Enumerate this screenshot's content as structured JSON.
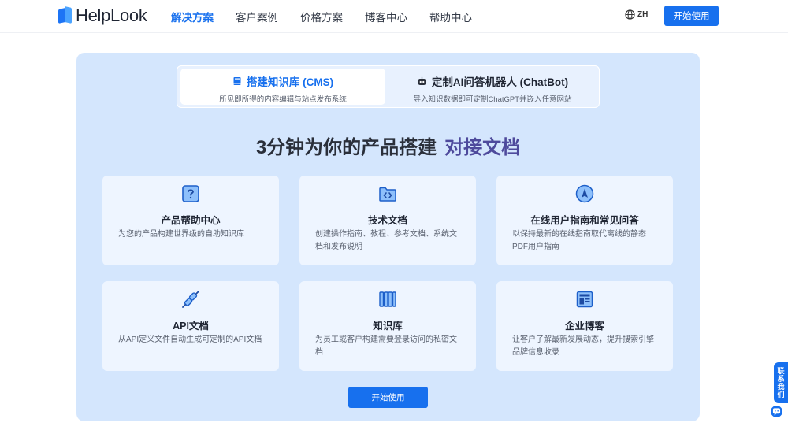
{
  "header": {
    "logo_text": "HelpLook",
    "nav": [
      "解决方案",
      "客户案例",
      "价格方案",
      "博客中心",
      "帮助中心"
    ],
    "active_nav": "解决方案",
    "language": "ZH",
    "cta": "开始使用"
  },
  "tabs": [
    {
      "title": "搭建知识库 (CMS)",
      "subtitle": "所见即所得的内容编辑与站点发布系统",
      "icon": "book-icon",
      "selected": true
    },
    {
      "title": "定制AI问答机器人 (ChatBot)",
      "subtitle": "导入知识数据即可定制ChatGPT并嵌入任意网站",
      "icon": "robot-icon",
      "selected": false
    }
  ],
  "heading": {
    "main": "3分钟为你的产品搭建",
    "highlight": "对接文档"
  },
  "cards": [
    {
      "title": "产品帮助中心",
      "desc": "为您的产品构建世界级的自助知识库",
      "icon": "question-icon"
    },
    {
      "title": "技术文档",
      "desc": "创建操作指南、教程、参考文档、系统文档和发布说明",
      "icon": "code-folder-icon"
    },
    {
      "title": "在线用户指南和常见问答",
      "desc": "以保持最新的在线指南取代离线的静态PDF用户指南",
      "icon": "navigation-icon"
    },
    {
      "title": "API文档",
      "desc": "从API定义文件自动生成可定制的API文档",
      "icon": "plug-icon"
    },
    {
      "title": "知识库",
      "desc": "为员工或客户构建需要登录访问的私密文档",
      "icon": "books-icon"
    },
    {
      "title": "企业博客",
      "desc": "让客户了解最新发展动态，提升搜索引擎品牌信息收录",
      "icon": "blog-icon"
    }
  ],
  "main_cta": "开始使用",
  "floating": {
    "contact_label": "联系我们",
    "chat_icon": "chat-icon"
  },
  "colors": {
    "primary": "#1770ee",
    "panel_bg": "#d4e6fd",
    "highlight": "#4e4a9c"
  }
}
